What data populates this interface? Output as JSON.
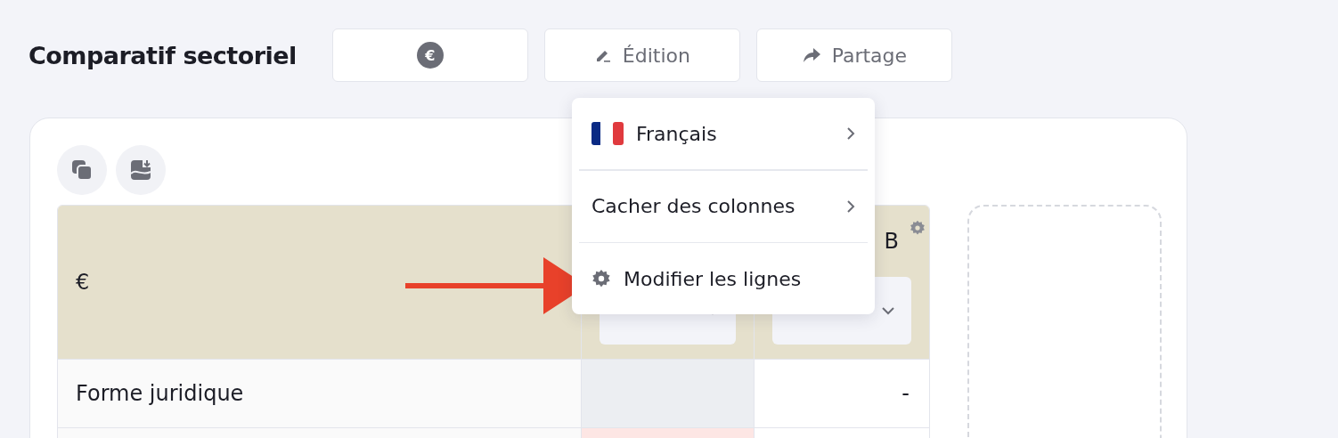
{
  "title": "Comparatif sectoriel",
  "toolbar": [
    {
      "kind": "currency",
      "symbol": "€"
    },
    {
      "kind": "edit",
      "label": "Édition"
    },
    {
      "kind": "share",
      "label": "Partage"
    }
  ],
  "card_actions": [
    {
      "kind": "copy"
    },
    {
      "kind": "export-image"
    }
  ],
  "table": {
    "columns": [
      {
        "kind": "label",
        "heading": "€"
      },
      {
        "kind": "select"
      },
      {
        "kind": "select",
        "heading": "B",
        "settings": true
      }
    ],
    "rows": [
      {
        "label": "Forme juridique",
        "cells": [
          {
            "kind": "empty"
          },
          {
            "kind": "plain",
            "value": "-"
          }
        ]
      },
      {
        "cells": [
          {
            "kind": "flagged"
          },
          {
            "kind": "plain"
          }
        ]
      }
    ]
  },
  "menu": [
    {
      "kind": "language",
      "label": "Français"
    },
    {
      "kind": "submenu",
      "label": "Cacher des colonnes"
    },
    {
      "kind": "action",
      "label": "Modifier les lignes"
    }
  ]
}
